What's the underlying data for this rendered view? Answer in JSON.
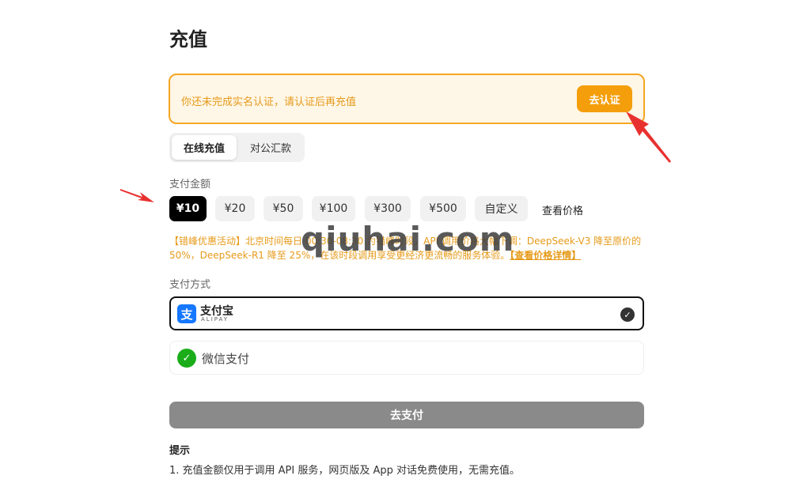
{
  "page": {
    "title": "充值"
  },
  "alert": {
    "message": "你还未完成实名认证，请认证后再充值",
    "button": "去认证"
  },
  "tabs": [
    {
      "label": "在线充值",
      "active": true
    },
    {
      "label": "对公汇款",
      "active": false
    }
  ],
  "amount": {
    "label": "支付金额",
    "options": [
      {
        "label": "¥10",
        "active": true
      },
      {
        "label": "¥20",
        "active": false
      },
      {
        "label": "¥50",
        "active": false
      },
      {
        "label": "¥100",
        "active": false
      },
      {
        "label": "¥300",
        "active": false
      },
      {
        "label": "¥500",
        "active": false
      },
      {
        "label": "自定义",
        "active": false
      }
    ],
    "view_price": "查看价格"
  },
  "promo": {
    "text": "【错峰优惠活动】北京时间每日 00:30-08:30 为错峰时段，API 调用价格大幅下调：DeepSeek-V3 降至原价的 50%，DeepSeek-R1 降至 25%，在该时段调用享受更经济更流畅的服务体验。",
    "link": "【查看价格详情】"
  },
  "payment": {
    "label": "支付方式",
    "alipay": {
      "name": "支付宝",
      "sub": "ALIPAY",
      "selected": true
    },
    "wechat": {
      "name": "微信支付",
      "selected": false
    },
    "submit": "去支付"
  },
  "tips": {
    "title": "提示",
    "lines": [
      "1. 充值金额仅用于调用 API 服务，网页版及 App 对话免费使用，无需充值。"
    ]
  },
  "watermark": "qiuhai.com",
  "colors": {
    "accent_orange": "#f59e0b",
    "alert_bg": "#fef6e6",
    "alipay_blue": "#1677ff",
    "wechat_green": "#1aad19",
    "annotation_red": "#e8312f"
  }
}
